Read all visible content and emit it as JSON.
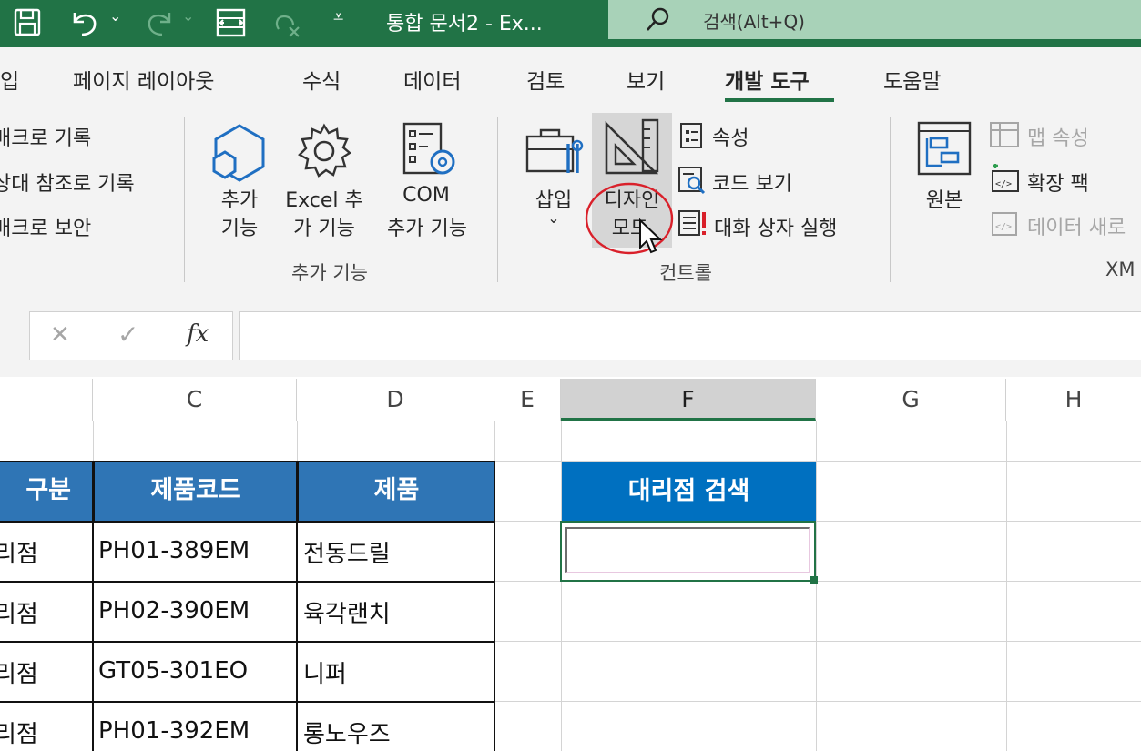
{
  "titlebar": {
    "doc_title": "통합 문서2  -  Ex...",
    "search_text": "검색(Alt+Q)"
  },
  "tabs": [
    {
      "label": "입"
    },
    {
      "label": "페이지 레이아웃"
    },
    {
      "label": "수식"
    },
    {
      "label": "데이터"
    },
    {
      "label": "검토"
    },
    {
      "label": "보기"
    },
    {
      "label": "개발 도구",
      "active": true
    },
    {
      "label": "도움말"
    }
  ],
  "ribbon": {
    "code": {
      "record_macro": "매크로 기록",
      "relative_ref": "상대 참조로 기록",
      "macro_security": "매크로 보안"
    },
    "addins": {
      "addin_l1": "추가",
      "addin_l2": "기능",
      "excel_addin_l1": "Excel 추",
      "excel_addin_l2": "가 기능",
      "com_addin_l1": "COM",
      "com_addin_l2": "추가 기능",
      "group_label": "추가 기능"
    },
    "controls": {
      "insert": "삽입",
      "design_mode_l1": "디자인",
      "design_mode_l2": "모드",
      "properties": "속성",
      "view_code": "코드 보기",
      "run_dialog": "대화 상자 실행",
      "group_label": "컨트롤"
    },
    "xml": {
      "source": "원본",
      "map_properties": "맵 속성",
      "expansion_packs": "확장 팩",
      "refresh_data": "데이터 새로",
      "group_label": "XM"
    }
  },
  "formula_bar": {
    "cancel": "✕",
    "enter": "✓",
    "fx": "fx",
    "value": ""
  },
  "columns": [
    "C",
    "D",
    "E",
    "F",
    "G",
    "H"
  ],
  "table": {
    "headers": [
      "구분",
      "제품코드",
      "제품"
    ],
    "rows": [
      {
        "b": "리점",
        "c": "PH01-389EM",
        "d": "전동드릴"
      },
      {
        "b": "리점",
        "c": "PH02-390EM",
        "d": "육각랜치"
      },
      {
        "b": "리점",
        "c": "GT05-301EO",
        "d": "니퍼"
      },
      {
        "b": "리점",
        "c": "PH01-392EM",
        "d": "롱노우즈"
      }
    ]
  },
  "search_panel": {
    "header": "대리점 검색",
    "input_value": ""
  },
  "colors": {
    "excel_green": "#217346",
    "header_blue": "#2f75b5",
    "annotation_red": "#d9202a"
  }
}
